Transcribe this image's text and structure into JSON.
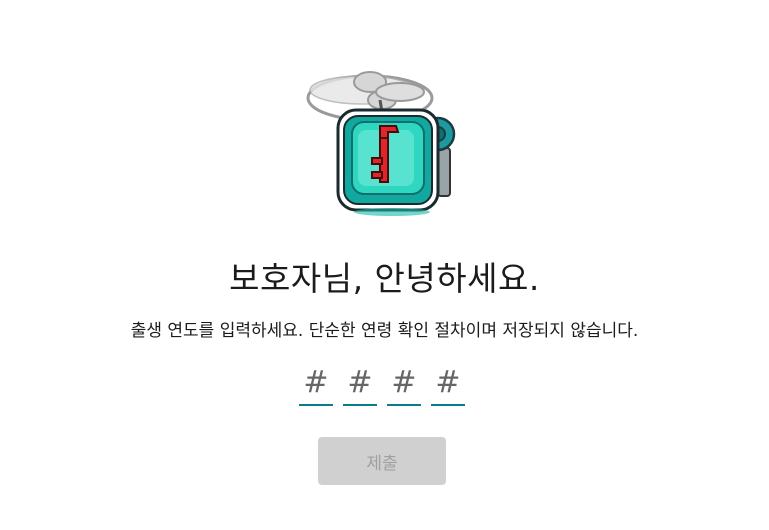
{
  "header": {
    "title": "보호자님, 안녕하세요.",
    "subtitle": "출생 연도를 입력하세요. 단순한 연령 확인 절차이며 저장되지 않습니다."
  },
  "year_input": {
    "digits": [
      {
        "placeholder": "#",
        "value": ""
      },
      {
        "placeholder": "#",
        "value": ""
      },
      {
        "placeholder": "#",
        "value": ""
      },
      {
        "placeholder": "#",
        "value": ""
      }
    ],
    "underline_color": "#0b7d8a"
  },
  "submit": {
    "label": "제출",
    "disabled": true,
    "bg_color": "#d0d0d0",
    "text_color": "#a0a0a0"
  },
  "illustration": {
    "icon": "flying-tv-key-icon",
    "colors": {
      "screen": "#2ec9b6",
      "frame": "#0e8c8a",
      "key": "#e0262b"
    }
  }
}
